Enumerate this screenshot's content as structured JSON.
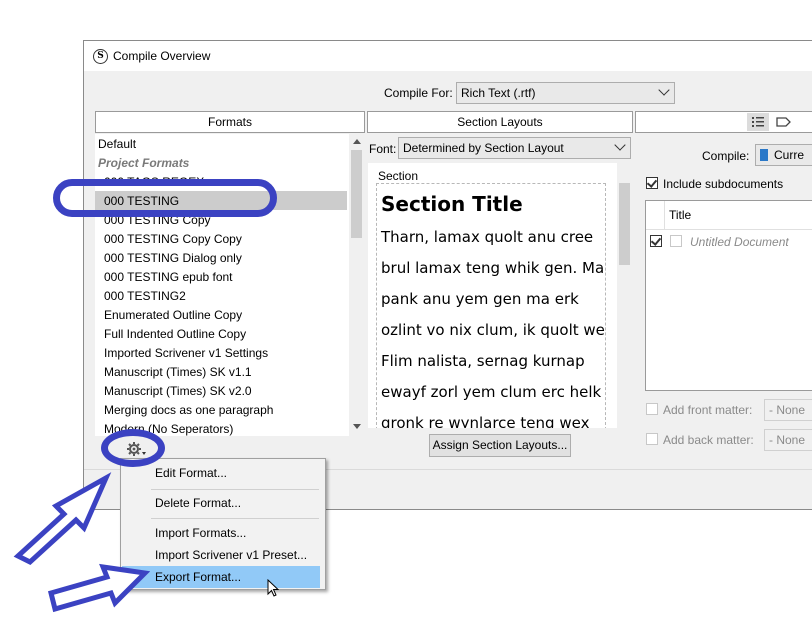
{
  "window": {
    "title": "Compile Overview",
    "app_icon": "S"
  },
  "compile_for": {
    "label": "Compile For:",
    "value": "Rich Text (.rtf)"
  },
  "formats": {
    "header": "Formats",
    "items": [
      {
        "label": "Default",
        "kind": "normal"
      },
      {
        "label": "Project Formats",
        "kind": "group"
      },
      {
        "label": "000 TAGS REGEX",
        "kind": "normal"
      },
      {
        "label": "000 TESTING",
        "kind": "selected"
      },
      {
        "label": "000 TESTING Copy",
        "kind": "normal"
      },
      {
        "label": "000 TESTING Copy Copy",
        "kind": "normal"
      },
      {
        "label": "000 TESTING Dialog only",
        "kind": "normal"
      },
      {
        "label": "000 TESTING epub font",
        "kind": "normal"
      },
      {
        "label": "000 TESTING2",
        "kind": "normal"
      },
      {
        "label": "Enumerated Outline Copy",
        "kind": "normal"
      },
      {
        "label": "Full Indented Outline Copy",
        "kind": "normal"
      },
      {
        "label": "Imported Scrivener v1 Settings",
        "kind": "normal"
      },
      {
        "label": "Manuscript (Times) SK v1.1",
        "kind": "normal"
      },
      {
        "label": "Manuscript (Times) SK v2.0",
        "kind": "normal"
      },
      {
        "label": "Merging docs as one paragraph",
        "kind": "normal"
      },
      {
        "label": "Modern (No Seperators)",
        "kind": "normal"
      }
    ]
  },
  "section_layouts": {
    "header": "Section Layouts",
    "font_label": "Font:",
    "font_value": "Determined by Section Layout",
    "section_caption": "Section",
    "preview_title": "Section Title",
    "preview_lines": [
      "Tharn, lamax quolt anu cree",
      "brul lamax teng whik gen. Ma",
      "pank anu yem gen ma erk",
      "ozlint vo nix clum, ik quolt wex.",
      "Flim nalista, sernag kurnap",
      "ewayf zorl yem clum erc helk",
      "gronk re wynlarce teng wex"
    ],
    "assign_button": "Assign Section Layouts..."
  },
  "right_panel": {
    "compile_label": "Compile:",
    "compile_value": "Curre",
    "include_subdocs": "Include subdocuments",
    "include_subdocs_checked": true,
    "column_title": "Title",
    "rows": [
      {
        "title": "Untitled Document",
        "checked": true
      }
    ],
    "front_matter_label": "Add front matter:",
    "front_matter_value": "- None",
    "back_matter_label": "Add back matter:",
    "back_matter_value": "- None"
  },
  "context_menu": {
    "items": [
      {
        "label": "Edit Format..."
      },
      {
        "label": "Delete Format..."
      },
      {
        "label": "Import Formats..."
      },
      {
        "label": "Import Scrivener v1 Preset..."
      },
      {
        "label": "Export Format...",
        "highlighted": true
      }
    ]
  },
  "colors": {
    "annotation": "#3b42c2",
    "menu_highlight": "#91c9f7",
    "selected_row": "#cccccc",
    "group_text": "#7a7a7a"
  },
  "icons": [
    "gear-icon",
    "dropdown-arrow-icon",
    "list-view-icon",
    "tag-icon",
    "mouse-cursor-icon",
    "annotation-arrow-icon"
  ]
}
